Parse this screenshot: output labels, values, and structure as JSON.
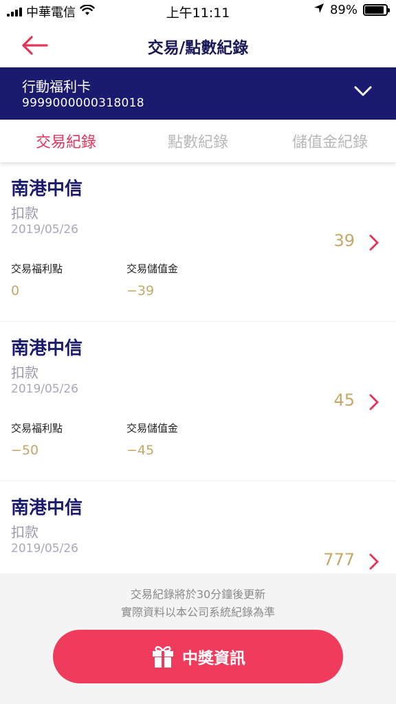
{
  "status_bar": {
    "carrier": "中華電信",
    "time": "上午11:11",
    "battery_percent": "89%",
    "battery_level": 0.89,
    "icons": [
      "signal-icon",
      "wifi-icon",
      "location-arrow-icon",
      "battery-icon"
    ]
  },
  "header": {
    "title": "交易/點數紀錄",
    "back_icon": "back-arrow-icon"
  },
  "card": {
    "name": "行動福利卡",
    "number": "9999000000318018",
    "chevron_icon": "chevron-down-icon"
  },
  "tabs": [
    {
      "label": "交易紀錄",
      "active": true
    },
    {
      "label": "點數紀錄",
      "active": false
    },
    {
      "label": "儲值金紀錄",
      "active": false
    }
  ],
  "records": [
    {
      "store": "南港中信",
      "type": "扣款",
      "date": "2019/05/26",
      "amount": "39",
      "points_label": "交易福利點",
      "points_value": "0",
      "stored_label": "交易儲值金",
      "stored_value": "−39"
    },
    {
      "store": "南港中信",
      "type": "扣款",
      "date": "2019/05/26",
      "amount": "45",
      "points_label": "交易福利點",
      "points_value": "−50",
      "stored_label": "交易儲值金",
      "stored_value": "−45"
    },
    {
      "store": "南港中信",
      "type": "扣款",
      "date": "2019/05/26",
      "amount": "777",
      "points_label": "",
      "points_value": "",
      "stored_label": "",
      "stored_value": ""
    }
  ],
  "footer": {
    "notice_line1": "交易紀錄將於30分鐘後更新",
    "notice_line2": "實際資料以本公司系統紀錄為準",
    "prize_button_label": "中獎資訊",
    "prize_icon": "gift-icon"
  },
  "colors": {
    "brand_navy": "#1a1a6e",
    "accent_red": "#e5345a",
    "button_red": "#ef3c5c",
    "amount_gold": "#c4a86a"
  }
}
